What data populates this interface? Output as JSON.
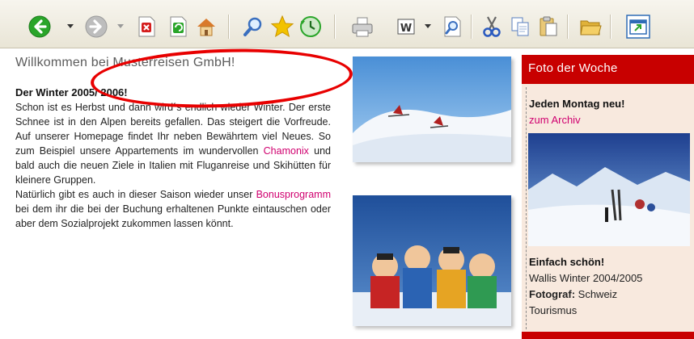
{
  "toolbar": {
    "buttons": [
      {
        "icon": "back-icon",
        "color": "#2aa52a"
      },
      {
        "icon": "forward-icon",
        "color": "#9a9a9a"
      },
      {
        "icon": "stop-icon",
        "color": "#d51f1f"
      },
      {
        "icon": "refresh-icon",
        "color": "#2aa52a"
      },
      {
        "icon": "home-icon",
        "color": "#d97a2b"
      },
      {
        "icon": "search-icon",
        "color": "#3a6fbf"
      },
      {
        "icon": "favorites-icon",
        "color": "#f2c200"
      },
      {
        "icon": "history-icon",
        "color": "#2aa52a"
      },
      {
        "icon": "print-icon",
        "color": "#777777"
      },
      {
        "icon": "edit-icon",
        "color": "#555555"
      },
      {
        "icon": "preview-icon",
        "color": "#3a6fbf"
      },
      {
        "icon": "cut-icon",
        "color": "#2c5bbf"
      },
      {
        "icon": "copy-icon",
        "color": "#5a7fbf"
      },
      {
        "icon": "paste-icon",
        "color": "#c8a64a"
      },
      {
        "icon": "folder-icon",
        "color": "#e0b23a"
      },
      {
        "icon": "new-window-icon",
        "color": "#2f6cb6"
      }
    ]
  },
  "main": {
    "welcome": "Willkommen bei Musterreisen GmbH!",
    "article_title": "Der Winter 2005/ 2006!",
    "para1_before_link": "Schon ist es Herbst und dann wird´s endlich wieder Winter. Der erste Schnee ist in den Alpen bereits gefallen. Das steigert die Vorfreude. Auf unserer Homepage findet Ihr neben Bewährtem viel Neues. So zum Beispiel unsere Appartements im wundervollen ",
    "para1_link": "Chamonix",
    "para1_after_link": " und bald auch die neuen Ziele in Italien mit Fluganreise und Skihütten für kleinere Gruppen.",
    "para2_before_link": "Natürlich gibt es auch in dieser Saison wieder unser ",
    "para2_link": "Bonusprogramm",
    "para2_after_link": " bei dem ihr die bei der Buchung erhaltenen Punkte eintauschen oder aber dem Sozialprojekt zukommen lassen könnt."
  },
  "panel": {
    "title": "Foto der Woche",
    "subtitle": "Jeden Montag neu!",
    "archive_link": "zum Archiv",
    "caption_title": "Einfach schön!",
    "caption_line": "Wallis Winter 2004/2005",
    "photographer_label": "Fotograf:",
    "photographer_value": " Schweiz",
    "photographer_value2": "Tourismus"
  },
  "colors": {
    "accent": "#c80000",
    "link": "#d0006f",
    "panel_bg": "#f8e9de",
    "highlight": "#e80000"
  }
}
